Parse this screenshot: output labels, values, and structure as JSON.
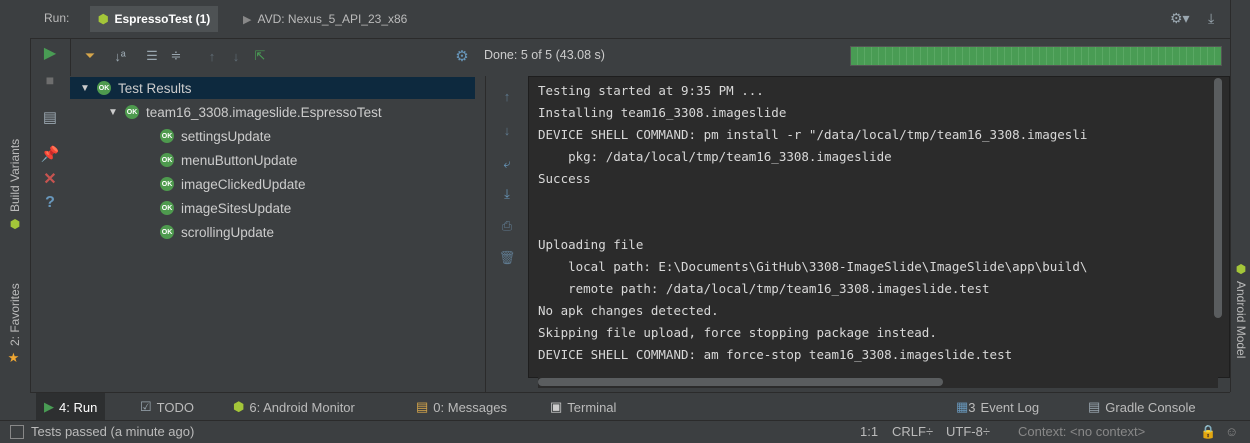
{
  "left_strip": {
    "build_variants": "Build Variants",
    "favorites": "2: Favorites"
  },
  "right_strip": {
    "android_model": "Android Model"
  },
  "header": {
    "run_label": "Run:",
    "tab1": "EspressoTest (1)",
    "tab2": "AVD: Nexus_5_API_23_x86"
  },
  "status": {
    "done_text": "Done: 5 of 5 (43.08 s)",
    "progress": 1.0,
    "progress_color": "#499c54"
  },
  "tree": {
    "root": "Test Results",
    "suite": "team16_3308.imageslide.EspressoTest",
    "badge": "OK",
    "tests": [
      "settingsUpdate",
      "menuButtonUpdate",
      "imageClickedUpdate",
      "imageSitesUpdate",
      "scrollingUpdate"
    ]
  },
  "console": {
    "lines": [
      "Testing started at 9:35 PM ...",
      "Installing team16_3308.imageslide",
      "DEVICE SHELL COMMAND: pm install -r \"/data/local/tmp/team16_3308.imagesli",
      "    pkg: /data/local/tmp/team16_3308.imageslide",
      "Success",
      "",
      "",
      "Uploading file",
      "    local path: E:\\Documents\\GitHub\\3308-ImageSlide\\ImageSlide\\app\\build\\",
      "    remote path: /data/local/tmp/team16_3308.imageslide.test",
      "No apk changes detected.",
      "Skipping file upload, force stopping package instead.",
      "DEVICE SHELL COMMAND: am force-stop team16_3308.imageslide.test"
    ]
  },
  "bottom_tabs": {
    "run": "4: Run",
    "todo": "TODO",
    "monitor": "6: Android Monitor",
    "messages": "0: Messages",
    "terminal": "Terminal",
    "event_log": "Event Log",
    "event_log_count": "3",
    "gradle": "Gradle Console"
  },
  "status_bar": {
    "message": "Tests passed (a minute ago)",
    "position": "1:1",
    "line_sep": "CRLF÷",
    "encoding": "UTF-8÷",
    "context": "Context: <no context>"
  },
  "colors": {
    "accent_green": "#499c54",
    "stop_red": "#c75450",
    "selection": "#0d293e"
  }
}
